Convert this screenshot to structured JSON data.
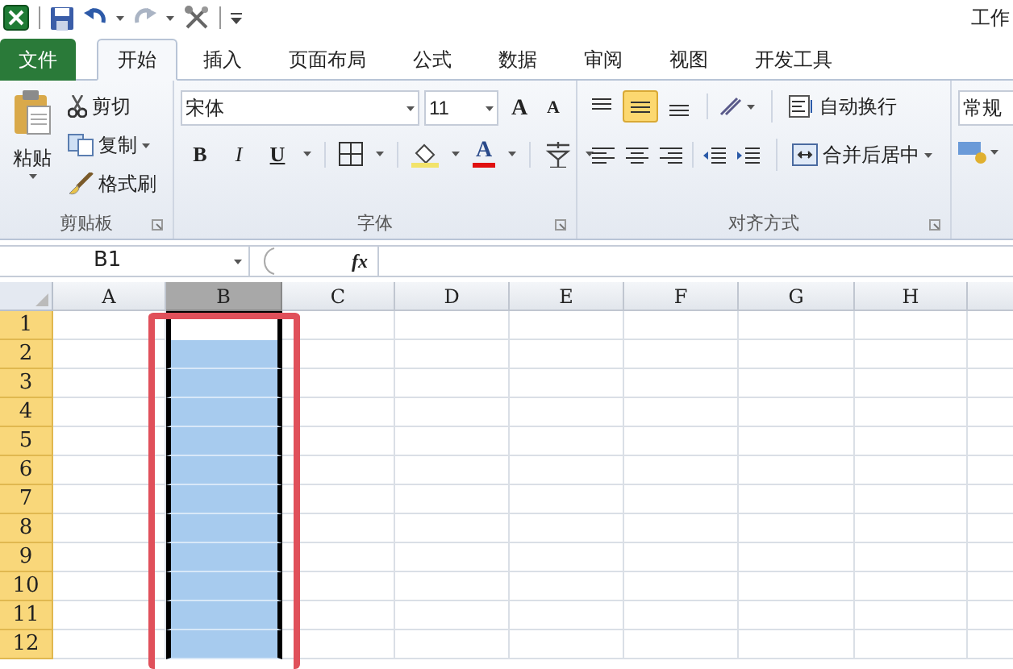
{
  "title_bar": {
    "title": "工作"
  },
  "tabs": [
    {
      "label": "文件",
      "kind": "file",
      "selected": false
    },
    {
      "label": "开始",
      "kind": "tab",
      "selected": true
    },
    {
      "label": "插入",
      "kind": "tab",
      "selected": false
    },
    {
      "label": "页面布局",
      "kind": "tab",
      "selected": false
    },
    {
      "label": "公式",
      "kind": "tab",
      "selected": false
    },
    {
      "label": "数据",
      "kind": "tab",
      "selected": false
    },
    {
      "label": "审阅",
      "kind": "tab",
      "selected": false
    },
    {
      "label": "视图",
      "kind": "tab",
      "selected": false
    },
    {
      "label": "开发工具",
      "kind": "tab",
      "selected": false
    }
  ],
  "ribbon": {
    "clipboard": {
      "paste": "粘贴",
      "cut": "剪切",
      "copy": "复制",
      "format_painter": "格式刷",
      "label": "剪贴板"
    },
    "font": {
      "font_name": "宋体",
      "font_size": "11",
      "grow": "A",
      "shrink": "A",
      "bold": "B",
      "italic": "I",
      "underline": "U",
      "font_color": "A",
      "label": "字体"
    },
    "alignment": {
      "vertical": [
        {
          "kind": "top",
          "selected": false
        },
        {
          "kind": "middle",
          "selected": true
        },
        {
          "kind": "bottom",
          "selected": false
        }
      ],
      "wrap_text": "自动换行",
      "merge_center": "合并后居中",
      "label": "对齐方式"
    },
    "number": {
      "format": "常规"
    }
  },
  "formula_bar": {
    "name_box": "B1",
    "fx": "fx"
  },
  "sheet": {
    "columns": [
      {
        "label": "A",
        "selected": false,
        "active": false
      },
      {
        "label": "B",
        "selected": true,
        "active": true
      },
      {
        "label": "C",
        "selected": false,
        "active": false
      },
      {
        "label": "D",
        "selected": false,
        "active": false
      },
      {
        "label": "E",
        "selected": false,
        "active": false
      },
      {
        "label": "F",
        "selected": false,
        "active": false
      },
      {
        "label": "G",
        "selected": false,
        "active": false
      },
      {
        "label": "H",
        "selected": false,
        "active": false
      }
    ],
    "rows": [
      {
        "label": "1",
        "selected": true,
        "active": true
      },
      {
        "label": "2",
        "selected": true,
        "active": false
      },
      {
        "label": "3",
        "selected": true,
        "active": false
      },
      {
        "label": "4",
        "selected": true,
        "active": false
      },
      {
        "label": "5",
        "selected": true,
        "active": false
      },
      {
        "label": "6",
        "selected": true,
        "active": false
      },
      {
        "label": "7",
        "selected": true,
        "active": false
      },
      {
        "label": "8",
        "selected": true,
        "active": false
      },
      {
        "label": "9",
        "selected": true,
        "active": false
      },
      {
        "label": "10",
        "selected": true,
        "active": false
      },
      {
        "label": "11",
        "selected": true,
        "active": false
      },
      {
        "label": "12",
        "selected": true,
        "active": false
      }
    ]
  }
}
